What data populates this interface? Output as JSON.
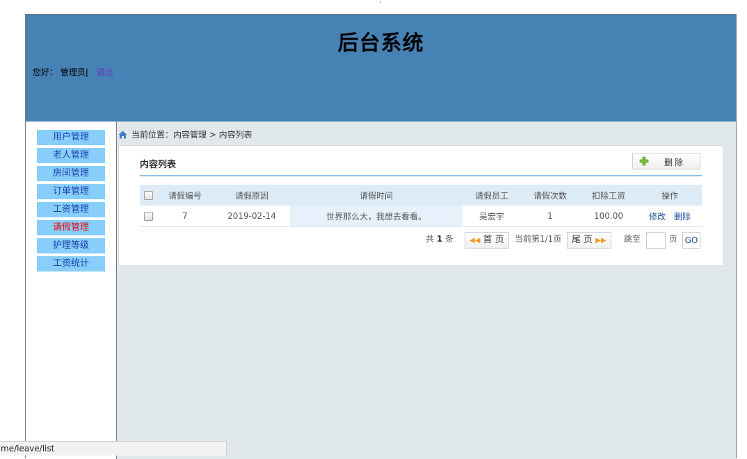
{
  "top_mark": "`",
  "header": {
    "title": "后台系统",
    "greeting": "您好：",
    "user": "管理员|",
    "logout": "退出"
  },
  "sidebar": {
    "items": [
      {
        "label": "用户管理"
      },
      {
        "label": "老人管理"
      },
      {
        "label": "房间管理"
      },
      {
        "label": "订单管理"
      },
      {
        "label": "工资管理"
      },
      {
        "label": "请假管理"
      },
      {
        "label": "护理等级"
      },
      {
        "label": "工资统计"
      }
    ],
    "active_index": 5
  },
  "breadcrumb": {
    "text": "当前位置：内容管理 > 内容列表"
  },
  "panel": {
    "title": "内容列表",
    "delete_label": "删除"
  },
  "table": {
    "headers": [
      "请假编号",
      "请假原因",
      "请假时间",
      "请假员工",
      "请假次数",
      "扣除工资",
      "操作"
    ],
    "rows": [
      {
        "id": "7",
        "reason": "2019-02-14",
        "time": "世界那么大，我想去看看。",
        "employee": "吴宏宇",
        "count": "1",
        "deduction": "100.00",
        "edit": "修改",
        "delete": "删除"
      }
    ]
  },
  "pager": {
    "total_prefix": "共",
    "total": "1",
    "total_suffix": "条",
    "first": "首 页",
    "current": "当前第1/1页",
    "last": "尾 页",
    "jump_label": "跳至",
    "page_label": "页",
    "go": "GO"
  },
  "status_bar": {
    "url": "me/leave/list"
  },
  "colors": {
    "header_bg": "#4682b4",
    "menu_bg": "#87cefa",
    "menu_active": "#e00000",
    "content_bg": "#e1e8ec"
  }
}
